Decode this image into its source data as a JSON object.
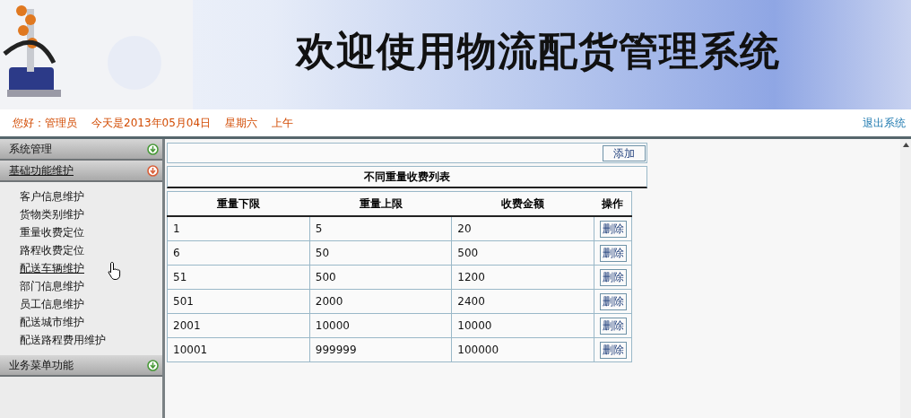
{
  "header": {
    "title": "欢迎使用物流配货管理系统"
  },
  "info_bar": {
    "greeting": "您好：管理员",
    "date": "今天是2013年05月04日",
    "weekday": "星期六",
    "period": "上午",
    "logout": "退出系统"
  },
  "sidebar": {
    "sections": [
      {
        "label": "系统管理",
        "expanded": false,
        "hovered": false
      },
      {
        "label": "基础功能维护",
        "expanded": true,
        "hovered": true,
        "items": [
          {
            "label": "客户信息维护",
            "hovered": false
          },
          {
            "label": "货物类别维护",
            "hovered": false
          },
          {
            "label": "重量收费定位",
            "hovered": false
          },
          {
            "label": "路程收费定位",
            "hovered": false
          },
          {
            "label": "配送车辆维护",
            "hovered": true
          },
          {
            "label": "部门信息维护",
            "hovered": false
          },
          {
            "label": "员工信息维护",
            "hovered": false
          },
          {
            "label": "配送城市维护",
            "hovered": false
          },
          {
            "label": "配送路程费用维护",
            "hovered": false
          }
        ]
      },
      {
        "label": "业务菜单功能",
        "expanded": false,
        "hovered": false
      }
    ]
  },
  "toolbar": {
    "add_button": "添加"
  },
  "table": {
    "title": "不同重量收费列表",
    "columns": [
      "重量下限",
      "重量上限",
      "收费金额",
      "操作"
    ],
    "rows": [
      {
        "cells": [
          "1",
          "5",
          "20"
        ],
        "action": "删除"
      },
      {
        "cells": [
          "6",
          "50",
          "500"
        ],
        "action": "删除"
      },
      {
        "cells": [
          "51",
          "500",
          "1200"
        ],
        "action": "删除"
      },
      {
        "cells": [
          "501",
          "2000",
          "2400"
        ],
        "action": "删除"
      },
      {
        "cells": [
          "2001",
          "10000",
          "10000"
        ],
        "action": "删除"
      },
      {
        "cells": [
          "10001",
          "999999",
          "100000"
        ],
        "action": "删除"
      }
    ]
  }
}
